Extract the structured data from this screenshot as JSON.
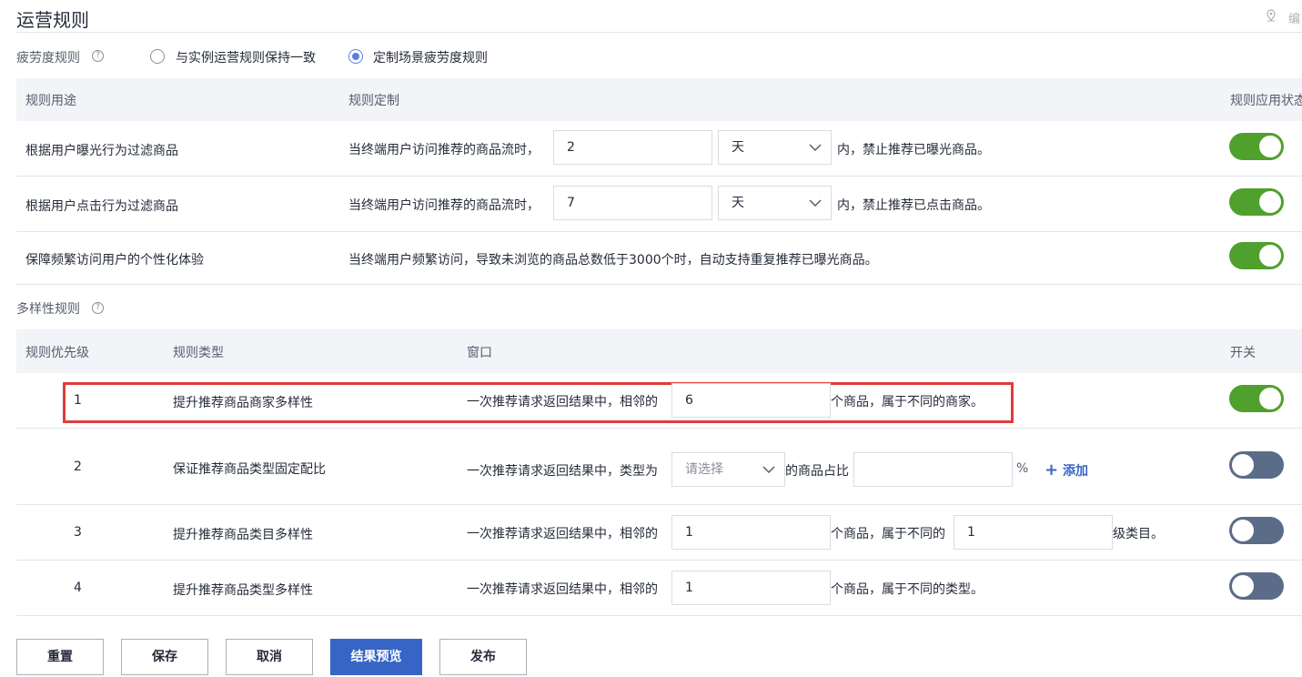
{
  "page": {
    "title": "运营规则",
    "top_right_text": "编"
  },
  "fatigue": {
    "label": "疲劳度规则",
    "help": "?",
    "option_inherit": "与实例运营规则保持一致",
    "option_custom": "定制场景疲劳度规则",
    "selected": "option_custom"
  },
  "fatigue_table": {
    "headers": {
      "usage": "规则用途",
      "custom": "规则定制",
      "status": "规则应用状态"
    },
    "rows": [
      {
        "usage": "根据用户曝光行为过滤商品",
        "prefix": "当终端用户访问推荐的商品流时，",
        "value": "2",
        "unit": "天",
        "suffix": "内，禁止推荐已曝光商品。",
        "enabled": true
      },
      {
        "usage": "根据用户点击行为过滤商品",
        "prefix": "当终端用户访问推荐的商品流时，",
        "value": "7",
        "unit": "天",
        "suffix": "内，禁止推荐已点击商品。",
        "enabled": true
      },
      {
        "usage": "保障频繁访问用户的个性化体验",
        "text": "当终端用户频繁访问，导致未浏览的商品总数低于3000个时，自动支持重复推荐已曝光商品。",
        "enabled": true
      }
    ]
  },
  "diversity": {
    "label": "多样性规则",
    "help": "?",
    "headers": {
      "priority": "规则优先级",
      "type": "规则类型",
      "window": "窗口",
      "switch": "开关"
    },
    "rows": [
      {
        "priority": "1",
        "type": "提升推荐商品商家多样性",
        "prefix": "一次推荐请求返回结果中，相邻的",
        "value": "6",
        "suffix": "个商品，属于不同的商家。",
        "enabled": true
      },
      {
        "priority": "2",
        "type": "保证推荐商品类型固定配比",
        "prefix": "一次推荐请求返回结果中，类型为",
        "select_placeholder": "请选择",
        "mid": "的商品占比",
        "value": "",
        "percent": "%",
        "add_icon": "+",
        "add_label": "添加",
        "enabled": false
      },
      {
        "priority": "3",
        "type": "提升推荐商品类目多样性",
        "prefix": "一次推荐请求返回结果中，相邻的",
        "value": "1",
        "mid": "个商品，属于不同的",
        "value2": "1",
        "suffix": "级类目。",
        "enabled": false
      },
      {
        "priority": "4",
        "type": "提升推荐商品类型多样性",
        "prefix": "一次推荐请求返回结果中，相邻的",
        "value": "1",
        "suffix": "个商品，属于不同的类型。",
        "enabled": false
      }
    ]
  },
  "buttons": {
    "reset": "重置",
    "save": "保存",
    "cancel": "取消",
    "preview": "结果预览",
    "publish": "发布"
  },
  "colors": {
    "accent": "#3765c6",
    "toggle_on": "#50a02d",
    "toggle_off": "#5a6c88",
    "highlight": "#e03b3b"
  }
}
